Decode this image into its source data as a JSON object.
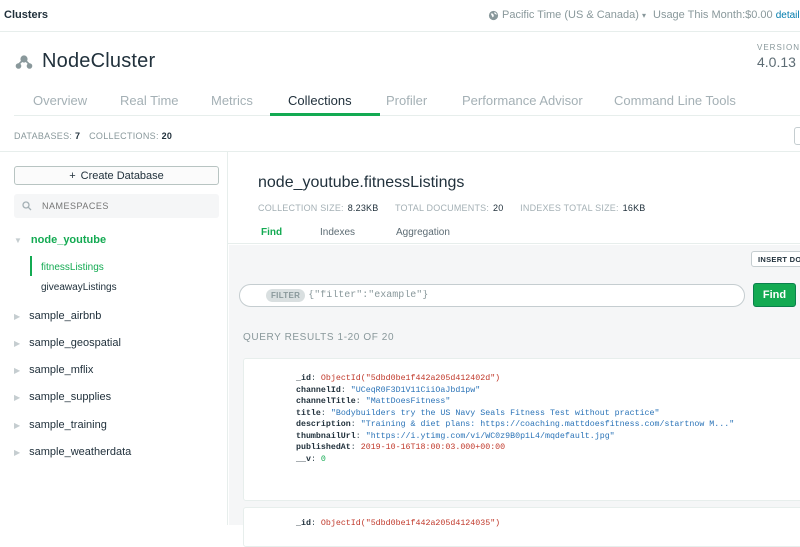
{
  "topbar": {
    "brand": "Clusters",
    "timezone": "Pacific Time (US & Canada)",
    "usage_label": "Usage This Month:",
    "usage_value": "$0.00",
    "usage_details": "details"
  },
  "cluster": {
    "name": "NodeCluster",
    "version_label": "VERSION",
    "version": "4.0.13"
  },
  "tabs": [
    "Overview",
    "Real Time",
    "Metrics",
    "Collections",
    "Profiler",
    "Performance Advisor",
    "Command Line Tools"
  ],
  "active_tab": "Collections",
  "stats": {
    "databases_label": "DATABASES:",
    "databases": "7",
    "collections_label": "COLLECTIONS:",
    "collections": "20"
  },
  "sidebar": {
    "create_db_label": "Create Database",
    "create_db_symbol": "+",
    "namespaces_placeholder": "NAMESPACES",
    "databases": [
      {
        "name": "node_youtube",
        "expanded": true,
        "collections": [
          "fitnessListings",
          "giveawayListings"
        ]
      },
      {
        "name": "sample_airbnb"
      },
      {
        "name": "sample_geospatial"
      },
      {
        "name": "sample_mflix"
      },
      {
        "name": "sample_supplies"
      },
      {
        "name": "sample_training"
      },
      {
        "name": "sample_weatherdata"
      }
    ],
    "active_collection": "fitnessListings"
  },
  "collection": {
    "title": "node_youtube.fitnessListings",
    "size_label": "COLLECTION SIZE:",
    "size": "8.23KB",
    "docs_label": "TOTAL DOCUMENTS:",
    "docs": "20",
    "indexes_label": "INDEXES TOTAL SIZE:",
    "indexes": "16KB",
    "subtabs": [
      "Find",
      "Indexes",
      "Aggregation"
    ],
    "active_subtab": "Find"
  },
  "query": {
    "insert_label": "INSERT DOCUMENT",
    "filter_label": "FILTER",
    "filter_value": "{\"filter\":\"example\"}",
    "find_label": "Find",
    "results_label": "QUERY RESULTS 1-20 OF 20"
  },
  "documents": [
    {
      "fields": [
        {
          "key": "_id",
          "value": "ObjectId(\"5dbd0be1f442a205d412402d\")",
          "type": "oid"
        },
        {
          "key": "channelId",
          "value": "\"UCeqR0F3D1V11CiiOaJbd1pw\"",
          "type": "str"
        },
        {
          "key": "channelTitle",
          "value": "\"MattDoesFitness\"",
          "type": "str"
        },
        {
          "key": "title",
          "value": "\"Bodybuilders try the US Navy Seals Fitness Test without practice\"",
          "type": "str"
        },
        {
          "key": "description",
          "value": "\"Training & diet plans: https://coaching.mattdoesfitness.com/startnow M...\"",
          "type": "str"
        },
        {
          "key": "thumbnailUrl",
          "value": "\"https://i.ytimg.com/vi/WC0z9B0p1L4/mqdefault.jpg\"",
          "type": "str"
        },
        {
          "key": "publishedAt",
          "value": "2019-10-16T18:00:03.000+00:00",
          "type": "date"
        },
        {
          "key": "__v",
          "value": "0",
          "type": "num"
        }
      ]
    },
    {
      "fields": [
        {
          "key": "_id",
          "value": "ObjectId(\"5dbd0be1f442a205d4124035\")",
          "type": "oid"
        }
      ]
    }
  ],
  "colors": {
    "accent_green": "#13aa52",
    "text_dark": "#21313c",
    "muted": "#89989b"
  }
}
